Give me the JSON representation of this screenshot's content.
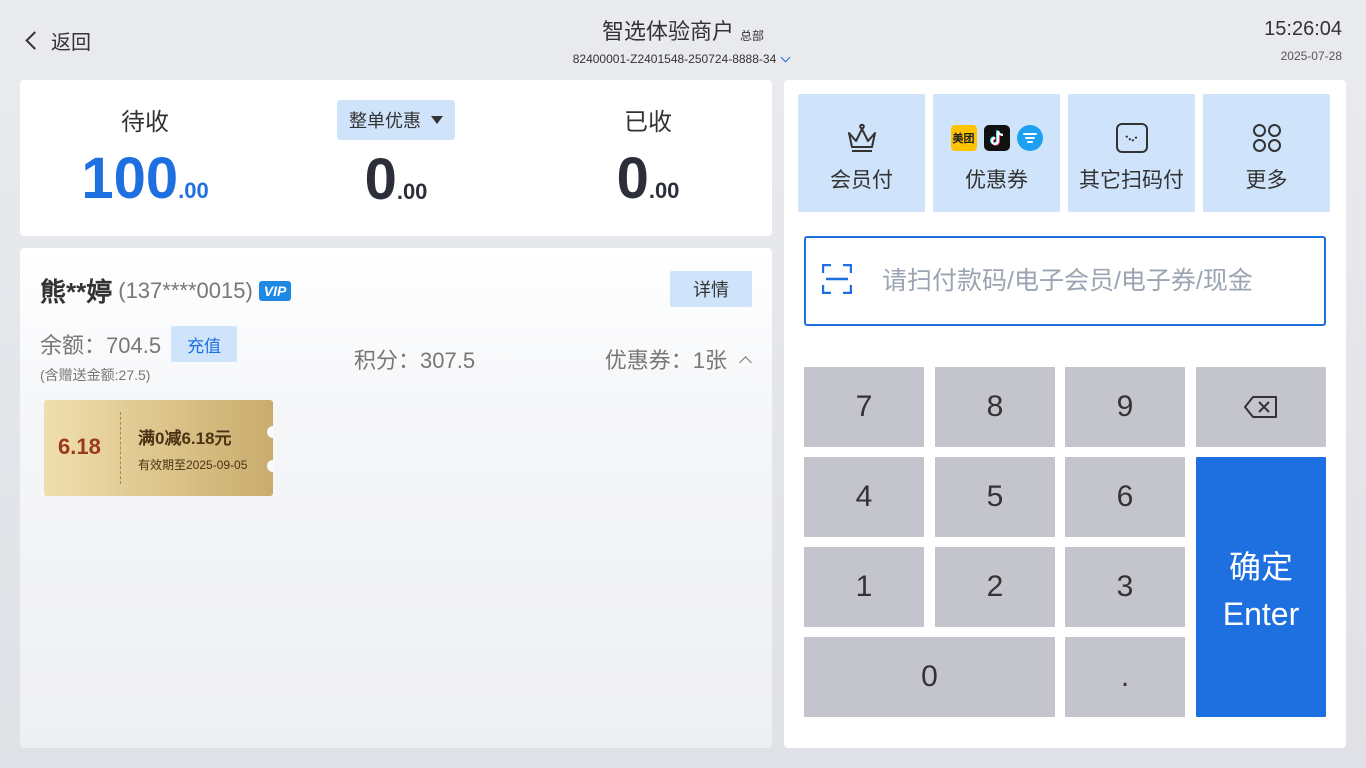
{
  "header": {
    "back_label": "返回",
    "store_name": "智选体验商户",
    "store_tag": "总部",
    "order_no": "82400001-Z2401548-250724-8888-34",
    "time": "15:26:04",
    "date": "2025-07-28"
  },
  "summary": {
    "pending": {
      "label": "待收",
      "int": "100",
      "dec": ".00"
    },
    "discount": {
      "label": "整单优惠",
      "int": "0",
      "dec": ".00"
    },
    "received": {
      "label": "已收",
      "int": "0",
      "dec": ".00"
    }
  },
  "member": {
    "name": "熊**婷",
    "phone": "(137****0015)",
    "vip_badge": "VIP",
    "detail_label": "详情",
    "balance_label": "余额：704.5",
    "recharge_label": "充值",
    "gift_note": "(含赠送金额:27.5)",
    "points_label": "积分：307.5",
    "coupons_label": "优惠券：1张",
    "coupon": {
      "value": "6.18",
      "title": "满0减6.18元",
      "expiry": "有效期至2025-09-05"
    }
  },
  "payment": {
    "methods": [
      {
        "label": "会员付",
        "icon": "crown-icon"
      },
      {
        "label": "优惠券",
        "icon": "coupon-platforms-icon",
        "brand_meituan": "美团"
      },
      {
        "label": "其它扫码付",
        "icon": "scan-pay-icon"
      },
      {
        "label": "更多",
        "icon": "grid-icon"
      }
    ],
    "scan_placeholder": "请扫付款码/电子会员/电子券/现金",
    "keys": {
      "k7": "7",
      "k8": "8",
      "k9": "9",
      "k4": "4",
      "k5": "5",
      "k6": "6",
      "k1": "1",
      "k2": "2",
      "k3": "3",
      "k0": "0",
      "kdot": "."
    },
    "confirm_cn": "确定",
    "confirm_en": "Enter",
    "accent": "#1e6fe0"
  }
}
